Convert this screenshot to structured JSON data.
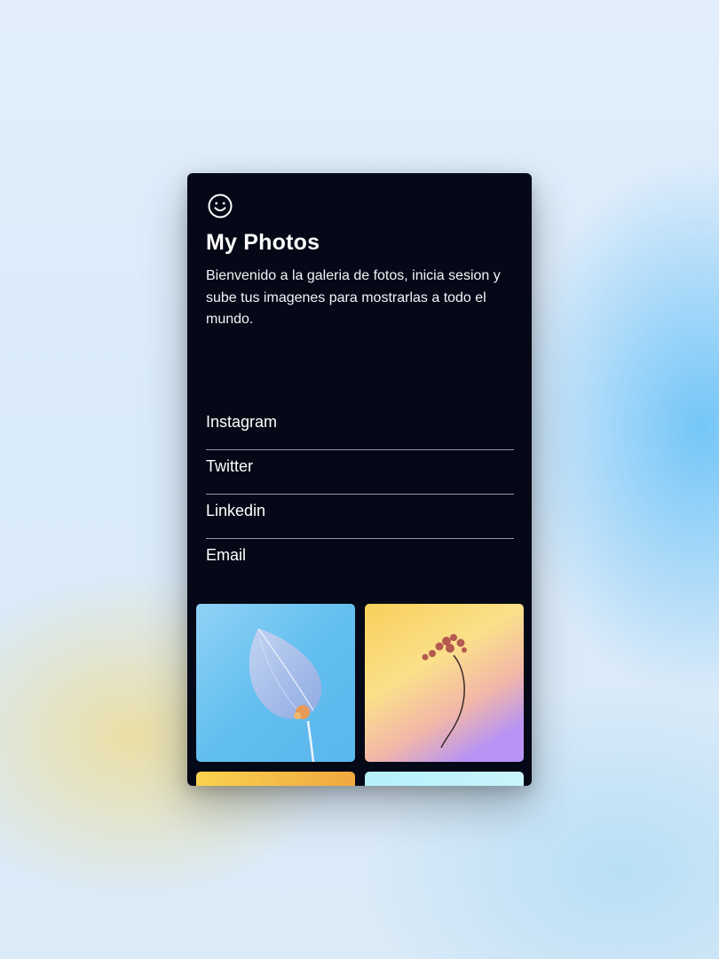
{
  "app": {
    "icon": "smile-icon",
    "title": "My Photos",
    "description": "Bienvenido a la galeria de fotos, inicia sesion y sube tus imagenes para mostrarlas a todo el mundo."
  },
  "links": [
    {
      "label": "Instagram"
    },
    {
      "label": "Twitter"
    },
    {
      "label": "Linkedin"
    },
    {
      "label": "Email"
    }
  ],
  "gallery": {
    "photos": [
      {
        "name": "physalis-leaf-photo",
        "palette": [
          "#63bff0",
          "#a9dcf8"
        ]
      },
      {
        "name": "dried-flower-photo",
        "palette": [
          "#f9d86c",
          "#c29bf5"
        ]
      },
      {
        "name": "orange-photo",
        "palette": [
          "#f9d24e",
          "#f0a840"
        ]
      },
      {
        "name": "cyan-photo",
        "palette": [
          "#b5f0fb",
          "#c9f4fb"
        ]
      }
    ]
  },
  "colors": {
    "card_background": "#050816",
    "divider": "#d2d6e0",
    "text": "#ffffff"
  }
}
